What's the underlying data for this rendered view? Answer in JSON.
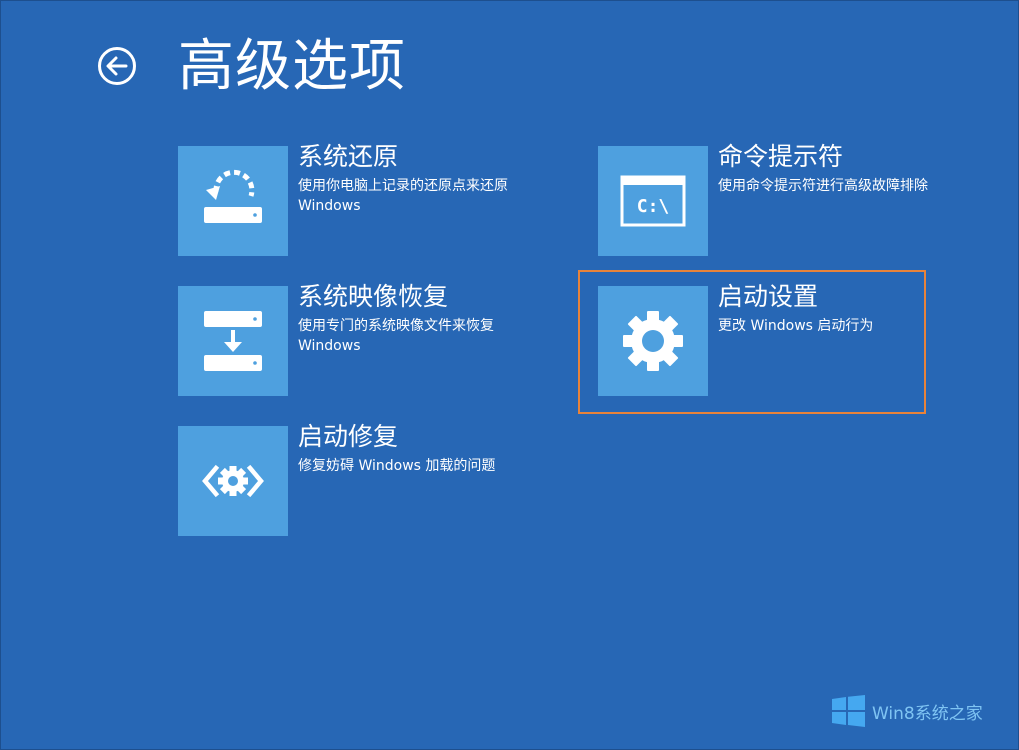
{
  "page": {
    "title": "高级选项",
    "back_icon": "back-arrow-icon"
  },
  "options": [
    {
      "id": "system-restore",
      "title": "系统还原",
      "desc_line1": "使用你电脑上记录的还原点来还原",
      "desc_line2": "Windows",
      "icon": "restore-drive-icon"
    },
    {
      "id": "command-prompt",
      "title": "命令提示符",
      "desc_line1": "使用命令提示符进行高级故障排除",
      "desc_line2": "",
      "icon": "command-prompt-icon",
      "icon_text": "C:\\"
    },
    {
      "id": "system-image-recovery",
      "title": "系统映像恢复",
      "desc_line1": "使用专门的系统映像文件来恢复",
      "desc_line2": "Windows",
      "icon": "image-recovery-icon"
    },
    {
      "id": "startup-settings",
      "title": "启动设置",
      "desc_line1": "更改 Windows 启动行为",
      "desc_line2": "",
      "icon": "gear-icon",
      "highlighted": true
    },
    {
      "id": "startup-repair",
      "title": "启动修复",
      "desc_line1": "修复妨碍 Windows 加载的问题",
      "desc_line2": "",
      "icon": "startup-repair-icon"
    }
  ],
  "watermark": {
    "text": "Win8系统之家",
    "logo": "windows-logo-icon"
  },
  "colors": {
    "background": "#2767b5",
    "tile": "#4ea0df",
    "highlight": "#e8833a",
    "watermark": "#7fc4f3"
  }
}
